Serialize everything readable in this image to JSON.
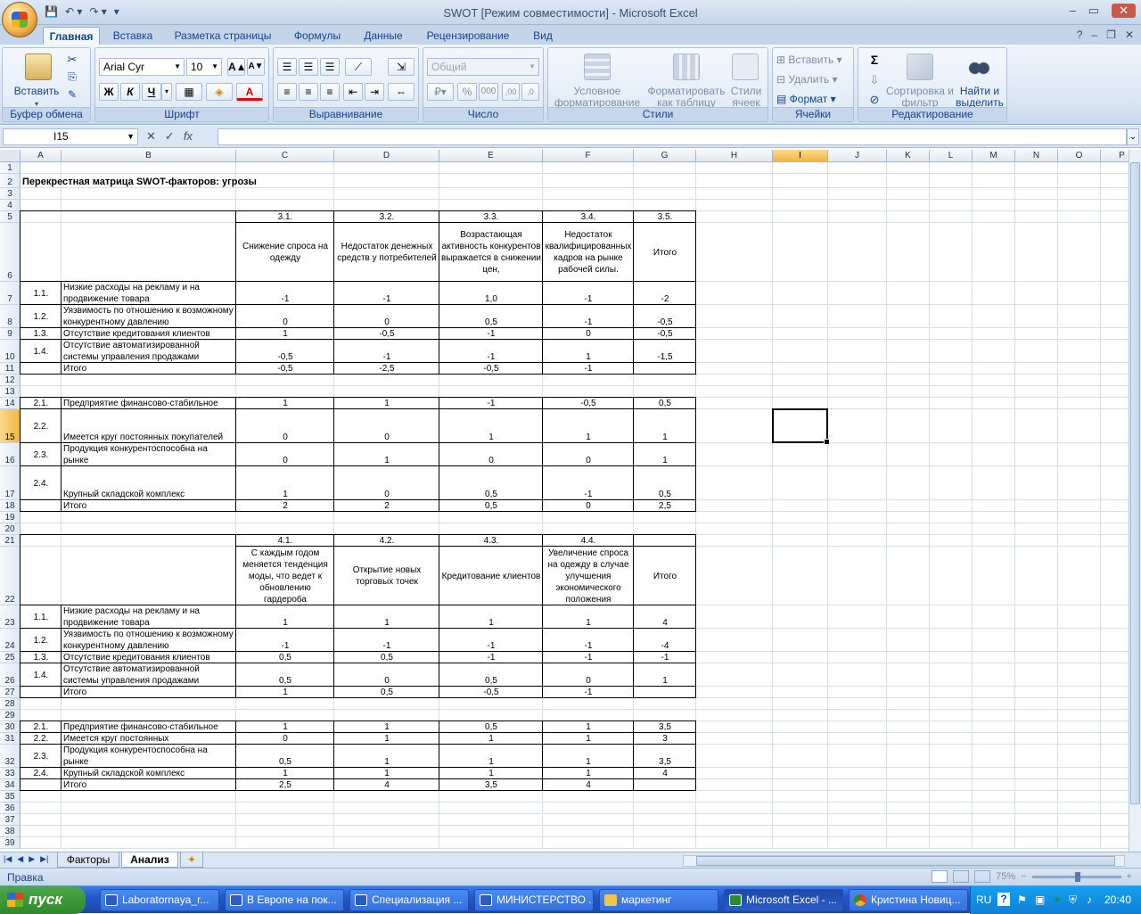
{
  "app": {
    "title": "SWOT  [Режим совместимости] - Microsoft Excel",
    "minimize": "–",
    "maximize": "▭",
    "close": "✕",
    "help_icon": "?",
    "doc_min": "–",
    "doc_restore": "❐",
    "doc_close": "✕"
  },
  "qat": {
    "save": "💾",
    "undo": "↶ ▾",
    "redo": "↷ ▾",
    "customize": "▾"
  },
  "tabs": [
    "Главная",
    "Вставка",
    "Разметка страницы",
    "Формулы",
    "Данные",
    "Рецензирование",
    "Вид"
  ],
  "ribbon": {
    "clipboard": {
      "label": "Буфер обмена",
      "paste": "Вставить",
      "paste_arrow": "▾"
    },
    "font": {
      "label": "Шрифт",
      "name": "Arial Cyr",
      "size": "10",
      "grow": "A▲",
      "shrink": "A▼",
      "bold": "Ж",
      "italic": "К",
      "underline": "Ч",
      "underline_arrow": "▾",
      "borders": "▦",
      "fill": "◈",
      "fontcolor": "A"
    },
    "alignment": {
      "label": "Выравнивание"
    },
    "number": {
      "label": "Число",
      "format": "Общий",
      "percent": "%",
      "thousands": "000",
      "dec_inc": ",00",
      "dec_dec": ",0"
    },
    "styles": {
      "label": "Стили",
      "cond_format": "Условное форматирование",
      "format_table": "Форматировать как таблицу",
      "cell_styles": "Стили ячеек"
    },
    "cells": {
      "label": "Ячейки",
      "insert": "Вставить",
      "delete": "Удалить",
      "format": "Формат"
    },
    "editing": {
      "label": "Редактирование",
      "sum": "Σ",
      "fill": "⇩",
      "clear": "⊘",
      "sort": "Сортировка и фильтр",
      "find": "Найти и выделить"
    }
  },
  "formula_bar": {
    "name_box": "I15",
    "cancel": "✕",
    "enter": "✓",
    "fx": "fx",
    "content": ""
  },
  "columns": [
    "A",
    "B",
    "C",
    "D",
    "E",
    "F",
    "G",
    "H",
    "I",
    "J",
    "K",
    "L",
    "M",
    "N",
    "O",
    "P"
  ],
  "rows": [
    "1",
    "2",
    "3",
    "4",
    "5",
    "6",
    "7",
    "8",
    "9",
    "10",
    "11",
    "12",
    "13",
    "14",
    "15",
    "16",
    "17",
    "18",
    "19",
    "20",
    "21",
    "22",
    "23",
    "24",
    "25",
    "26",
    "27",
    "28",
    "29",
    "30",
    "31",
    "32",
    "33",
    "34",
    "35",
    "36",
    "37",
    "38",
    "39"
  ],
  "sheet": {
    "title": "Перекрестная матрица SWOT-факторов: угрозы",
    "t1_codes": [
      "3.1.",
      "3.2.",
      "3.3.",
      "3.4.",
      "3.5."
    ],
    "t1_heads": [
      "Снижение спроса на одежду",
      "Недостаток денежных средств у потребителей",
      "Возрастающая активность конкурентов выражается в снижении цен,",
      "Недостаток квалифицированных кадров на рынке рабочей силы.",
      "Итого"
    ],
    "t1_rows": [
      {
        "code": "1.1.",
        "label": "Низкие расходы на рекламу и на продвижение товара",
        "vals": [
          "-1",
          "-1",
          "1,0",
          "-1",
          "-2"
        ]
      },
      {
        "code": "1.2.",
        "label": "Уязвимость по отношению к возможному конкурентному давлению",
        "vals": [
          "0",
          "0",
          "0,5",
          "-1",
          "-0,5"
        ]
      },
      {
        "code": "1.3.",
        "label": "Отсутствие кредитования клиентов",
        "vals": [
          "1",
          "-0,5",
          "-1",
          "0",
          "-0,5"
        ]
      },
      {
        "code": "1.4.",
        "label": "Отсутствие автоматизированной системы управления продажами",
        "vals": [
          "-0,5",
          "-1",
          "-1",
          "1",
          "-1,5"
        ]
      },
      {
        "code": "",
        "label": "Итого",
        "vals": [
          "-0,5",
          "-2,5",
          "-0,5",
          "-1",
          ""
        ]
      }
    ],
    "t2_rows": [
      {
        "code": "2.1.",
        "label": "Предприятие финансово-стабильное",
        "vals": [
          "1",
          "1",
          "-1",
          "-0,5",
          "0,5"
        ]
      },
      {
        "code": "2.2.",
        "label": "Имеется круг постоянных покупателей",
        "vals": [
          "0",
          "0",
          "1",
          "1",
          "1"
        ]
      },
      {
        "code": "2.3.",
        "label": "Продукция конкурентоспособна на рынке",
        "vals": [
          "0",
          "1",
          "0",
          "0",
          "1"
        ]
      },
      {
        "code": "2.4.",
        "label": "Крупный складской комплекс",
        "vals": [
          "1",
          "0",
          "0,5",
          "-1",
          "0,5"
        ]
      },
      {
        "code": "",
        "label": "Итого",
        "vals": [
          "2",
          "2",
          "0,5",
          "0",
          "2,5"
        ]
      }
    ],
    "t3_codes": [
      "4.1.",
      "4.2.",
      "4.3.",
      "4.4.",
      ""
    ],
    "t3_heads": [
      "С каждым годом меняется тенденция моды, что ведет к обновлению гардероба",
      "Открытие новых торговых точек",
      "Кредитование клиентов",
      "Увеличение спроса на одежду в случае улучшения экономического положения",
      "Итого"
    ],
    "t3_rows": [
      {
        "code": "1.1.",
        "label": "Низкие расходы на рекламу и на продвижение товара",
        "vals": [
          "1",
          "1",
          "1",
          "1",
          "4"
        ]
      },
      {
        "code": "1.2.",
        "label": "Уязвимость по отношению к возможному конкурентному давлению",
        "vals": [
          "-1",
          "-1",
          "-1",
          "-1",
          "-4"
        ]
      },
      {
        "code": "1.3.",
        "label": "Отсутствие кредитования клиентов",
        "vals": [
          "0,5",
          "0,5",
          "-1",
          "-1",
          "-1"
        ]
      },
      {
        "code": "1.4.",
        "label": "Отсутствие автоматизированной системы управления продажами",
        "vals": [
          "0,5",
          "0",
          "0,5",
          "0",
          "1"
        ]
      },
      {
        "code": "",
        "label": "Итого",
        "vals": [
          "1",
          "0,5",
          "-0,5",
          "-1",
          ""
        ]
      }
    ],
    "t4_rows": [
      {
        "code": "2.1.",
        "label": "Предприятие финансово-стабильное",
        "vals": [
          "1",
          "1",
          "0,5",
          "1",
          "3,5"
        ]
      },
      {
        "code": "2.2.",
        "label": "Имеется круг постоянных",
        "vals": [
          "0",
          "1",
          "1",
          "1",
          "3"
        ]
      },
      {
        "code": "2.3.",
        "label": "Продукция конкурентоспособна на рынке",
        "vals": [
          "0,5",
          "1",
          "1",
          "1",
          "3,5"
        ]
      },
      {
        "code": "2.4.",
        "label": "Крупный складской комплекс",
        "vals": [
          "1",
          "1",
          "1",
          "1",
          "4"
        ]
      },
      {
        "code": "",
        "label": "Итого",
        "vals": [
          "2,5",
          "4",
          "3,5",
          "4",
          ""
        ]
      }
    ]
  },
  "sheet_tabs": {
    "nav": [
      "|◀",
      "◀",
      "▶",
      "▶|"
    ],
    "tabs": [
      "Факторы",
      "Анализ"
    ],
    "active": "Анализ",
    "new_icon": "✦"
  },
  "status": {
    "text": "Правка",
    "zoom": "75%",
    "zoom_out": "−",
    "zoom_in": "+"
  },
  "taskbar": {
    "start": "пуск",
    "items": [
      "Laboratornaya_r...",
      "В Европе на пок...",
      "Специализация ...",
      "МИНИСТЕРСТВО ...",
      "маркетинг",
      "Microsoft Excel - ...",
      "Кристина Новиц..."
    ],
    "active": "Microsoft Excel - ...",
    "lang": "RU",
    "help": "?",
    "clock": "20:40"
  },
  "colors": {
    "ribbon": "#dae6f4",
    "selected_header": "#f2b545",
    "taskbar": "#2357c8",
    "start": "#2f8a2a"
  }
}
